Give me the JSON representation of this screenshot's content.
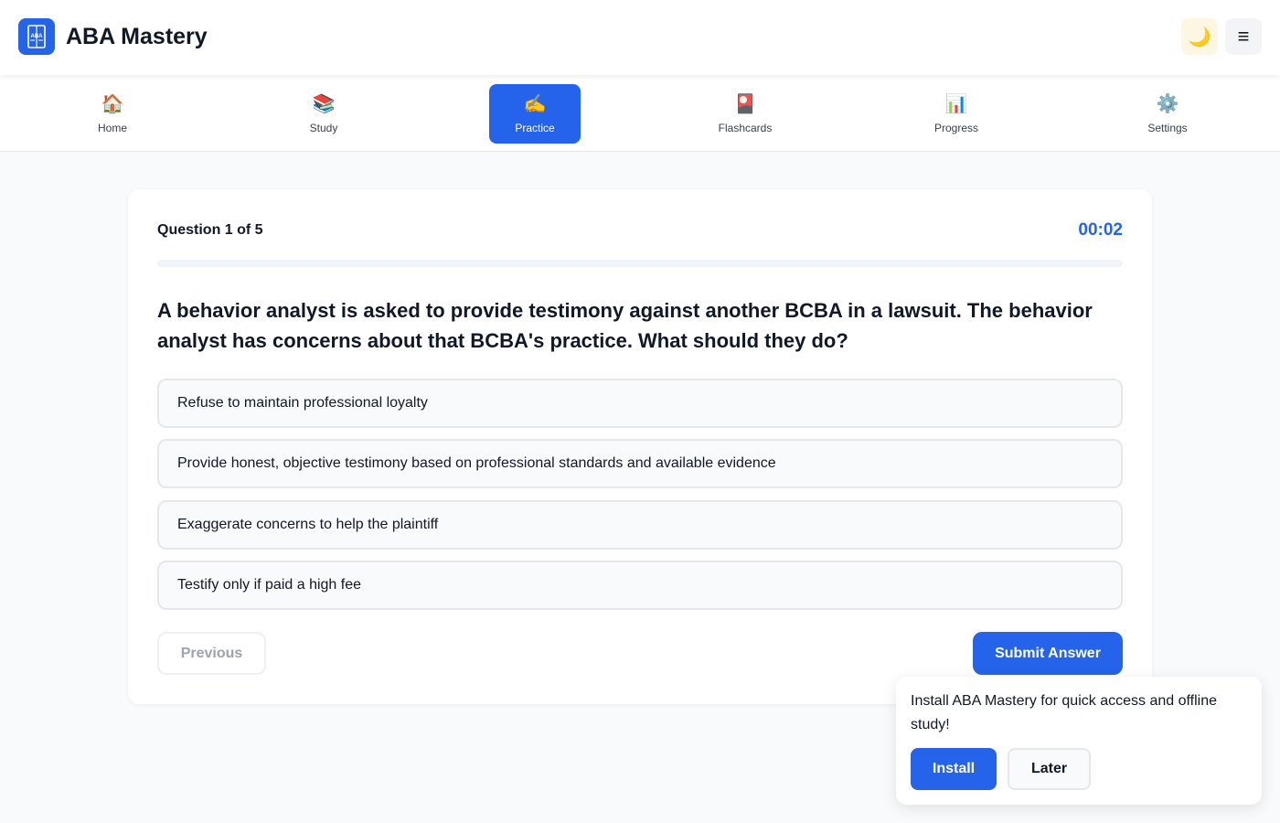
{
  "app": {
    "title": "ABA Mastery",
    "logo_text": "ABA",
    "logo_icon": "book-icon",
    "theme_toggle_icon": "🌙",
    "menu_icon": "≡"
  },
  "nav": {
    "items": [
      {
        "label": "Home",
        "icon": "🏠",
        "icon_name": "house-icon",
        "active": false
      },
      {
        "label": "Study",
        "icon": "📚",
        "icon_name": "books-icon",
        "active": false
      },
      {
        "label": "Practice",
        "icon": "✍️",
        "icon_name": "writing-hand-icon",
        "active": true
      },
      {
        "label": "Flashcards",
        "icon": "🎴",
        "icon_name": "flashcard-icon",
        "active": false
      },
      {
        "label": "Progress",
        "icon": "📊",
        "icon_name": "bar-chart-icon",
        "active": false
      },
      {
        "label": "Settings",
        "icon": "⚙️",
        "icon_name": "gear-icon",
        "active": false
      }
    ]
  },
  "quiz": {
    "counter": "Question 1 of 5",
    "timer": "00:02",
    "progress": 0,
    "question": "A behavior analyst is asked to provide testimony against another BCBA in a lawsuit. The behavior analyst has concerns about that BCBA's practice. What should they do?",
    "options": [
      "Refuse to maintain professional loyalty",
      "Provide honest, objective testimony based on professional standards and available evidence",
      "Exaggerate concerns to help the plaintiff",
      "Testify only if paid a high fee"
    ],
    "previous_label": "Previous",
    "submit_label": "Submit Answer"
  },
  "install_prompt": {
    "message": "Install ABA Mastery for quick access and offline study!",
    "install_label": "Install",
    "later_label": "Later"
  },
  "colors": {
    "accent": "#2563eb",
    "background": "#f8fafc",
    "text": "#111827"
  }
}
